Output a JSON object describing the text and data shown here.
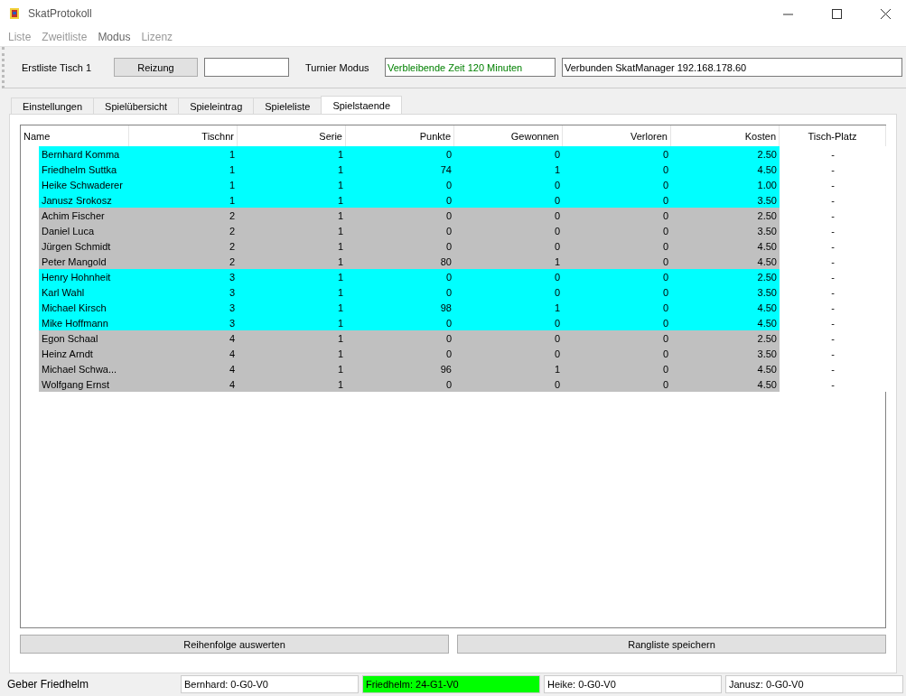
{
  "window": {
    "title": "SkatProtokoll"
  },
  "menu": [
    {
      "label": "Liste",
      "disabled": true
    },
    {
      "label": "Zweitliste",
      "disabled": true
    },
    {
      "label": "Modus",
      "disabled": false
    },
    {
      "label": "Lizenz",
      "disabled": true
    }
  ],
  "toolbar": {
    "list_label": "Erstliste Tisch 1",
    "reizung_button": "Reizung",
    "mode_label": "Turnier Modus",
    "remaining_time": "Verbleibende Zeit 120 Minuten",
    "connection": "Verbunden SkatManager 192.168.178.60"
  },
  "tabs": [
    {
      "label": "Einstellungen",
      "selected": false
    },
    {
      "label": "Spielübersicht",
      "selected": false
    },
    {
      "label": "Spieleintrag",
      "selected": false
    },
    {
      "label": "Spieleliste",
      "selected": false
    },
    {
      "label": "Spielstaende",
      "selected": true
    }
  ],
  "table": {
    "columns": [
      "Name",
      "Tischnr",
      "Serie",
      "Punkte",
      "Gewonnen",
      "Verloren",
      "Kosten",
      "Tisch-Platz"
    ],
    "rows": [
      {
        "color": "#00ffff",
        "cells": [
          "Bernhard Komma",
          "1",
          "1",
          "0",
          "0",
          "0",
          "2.50",
          "-"
        ]
      },
      {
        "color": "#00ffff",
        "cells": [
          "Friedhelm Suttka",
          "1",
          "1",
          "74",
          "1",
          "0",
          "4.50",
          "-"
        ]
      },
      {
        "color": "#00ffff",
        "cells": [
          "Heike Schwaderer",
          "1",
          "1",
          "0",
          "0",
          "0",
          "1.00",
          "-"
        ]
      },
      {
        "color": "#00ffff",
        "cells": [
          "Janusz Srokosz",
          "1",
          "1",
          "0",
          "0",
          "0",
          "3.50",
          "-"
        ]
      },
      {
        "color": "#c0c0c0",
        "cells": [
          "Achim Fischer",
          "2",
          "1",
          "0",
          "0",
          "0",
          "2.50",
          "-"
        ]
      },
      {
        "color": "#c0c0c0",
        "cells": [
          "Daniel Luca",
          "2",
          "1",
          "0",
          "0",
          "0",
          "3.50",
          "-"
        ]
      },
      {
        "color": "#c0c0c0",
        "cells": [
          "Jürgen Schmidt",
          "2",
          "1",
          "0",
          "0",
          "0",
          "4.50",
          "-"
        ]
      },
      {
        "color": "#c0c0c0",
        "cells": [
          "Peter Mangold",
          "2",
          "1",
          "80",
          "1",
          "0",
          "4.50",
          "-"
        ]
      },
      {
        "color": "#00ffff",
        "cells": [
          "Henry Hohnheit",
          "3",
          "1",
          "0",
          "0",
          "0",
          "2.50",
          "-"
        ]
      },
      {
        "color": "#00ffff",
        "cells": [
          "Karl Wahl",
          "3",
          "1",
          "0",
          "0",
          "0",
          "3.50",
          "-"
        ]
      },
      {
        "color": "#00ffff",
        "cells": [
          "Michael Kirsch",
          "3",
          "1",
          "98",
          "1",
          "0",
          "4.50",
          "-"
        ]
      },
      {
        "color": "#00ffff",
        "cells": [
          "Mike Hoffmann",
          "3",
          "1",
          "0",
          "0",
          "0",
          "4.50",
          "-"
        ]
      },
      {
        "color": "#c0c0c0",
        "cells": [
          "Egon Schaal",
          "4",
          "1",
          "0",
          "0",
          "0",
          "2.50",
          "-"
        ]
      },
      {
        "color": "#c0c0c0",
        "cells": [
          "Heinz Arndt",
          "4",
          "1",
          "0",
          "0",
          "0",
          "3.50",
          "-"
        ]
      },
      {
        "color": "#c0c0c0",
        "cells": [
          "Michael Schwa...",
          "4",
          "1",
          "96",
          "1",
          "0",
          "4.50",
          "-"
        ]
      },
      {
        "color": "#c0c0c0",
        "cells": [
          "Wolfgang Ernst",
          "4",
          "1",
          "0",
          "0",
          "0",
          "4.50",
          "-"
        ]
      }
    ]
  },
  "buttons": [
    "Reihenfolge auswerten",
    "Rangliste speichern"
  ],
  "status_bar": {
    "dealer": "Geber Friedhelm",
    "players": [
      {
        "text": "Bernhard: 0-G0-V0",
        "highlighted": false
      },
      {
        "text": "Friedhelm: 24-G1-V0",
        "highlighted": true
      },
      {
        "text": "Heike: 0-G0-V0",
        "highlighted": false
      },
      {
        "text": "Janusz: 0-G0-V0",
        "highlighted": false
      }
    ]
  }
}
